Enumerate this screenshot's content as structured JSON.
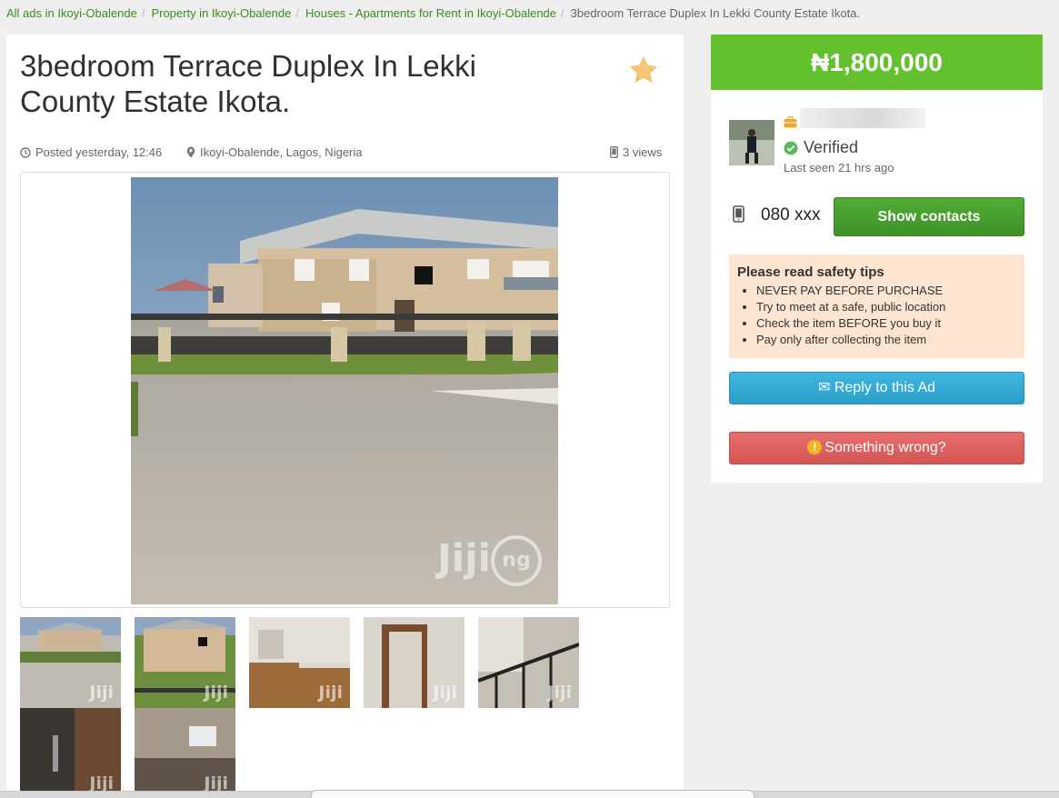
{
  "breadcrumb": {
    "items": [
      "All ads in Ikoyi-Obalende",
      "Property in Ikoyi-Obalende",
      "Houses - Apartments for Rent in Ikoyi-Obalende"
    ],
    "separator": "/",
    "current": "3bedroom Terrace Duplex In Lekki County Estate Ikota."
  },
  "ad": {
    "title": "3bedroom Terrace Duplex In Lekki County Estate Ikota.",
    "posted": "Posted yesterday, 12:46",
    "location": "Ikoyi-Obalende, Lagos, Nigeria",
    "views": "3 views",
    "favorite_icon": "star-icon",
    "photo_watermark": "Jiji",
    "photo_watermark_badge": "ng",
    "thumbnail_count": 7
  },
  "sidebar": {
    "price": "₦1,800,000",
    "verified": "Verified",
    "last_seen": "Last seen 21 hrs ago",
    "phone": "080 xxx",
    "show_contacts": "Show contacts",
    "safety": {
      "title": "Please read safety tips",
      "tips": [
        "NEVER PAY BEFORE PURCHASE",
        "Try to meet at a safe, public location",
        "Check the item BEFORE you buy it",
        "Pay only after collecting the item"
      ]
    },
    "reply": "Reply to this Ad",
    "wrong": "Something wrong?",
    "wrong_glyph": "!",
    "reply_glyph": "✉"
  },
  "colors": {
    "price_green": "#62c12d",
    "link_green": "#3c8b1e",
    "contacts_green": "#4aa331",
    "reply_blue": "#36aad6",
    "wrong_red": "#dc5f5d",
    "tips_bg": "#fde5d1",
    "star": "#f6c477"
  }
}
